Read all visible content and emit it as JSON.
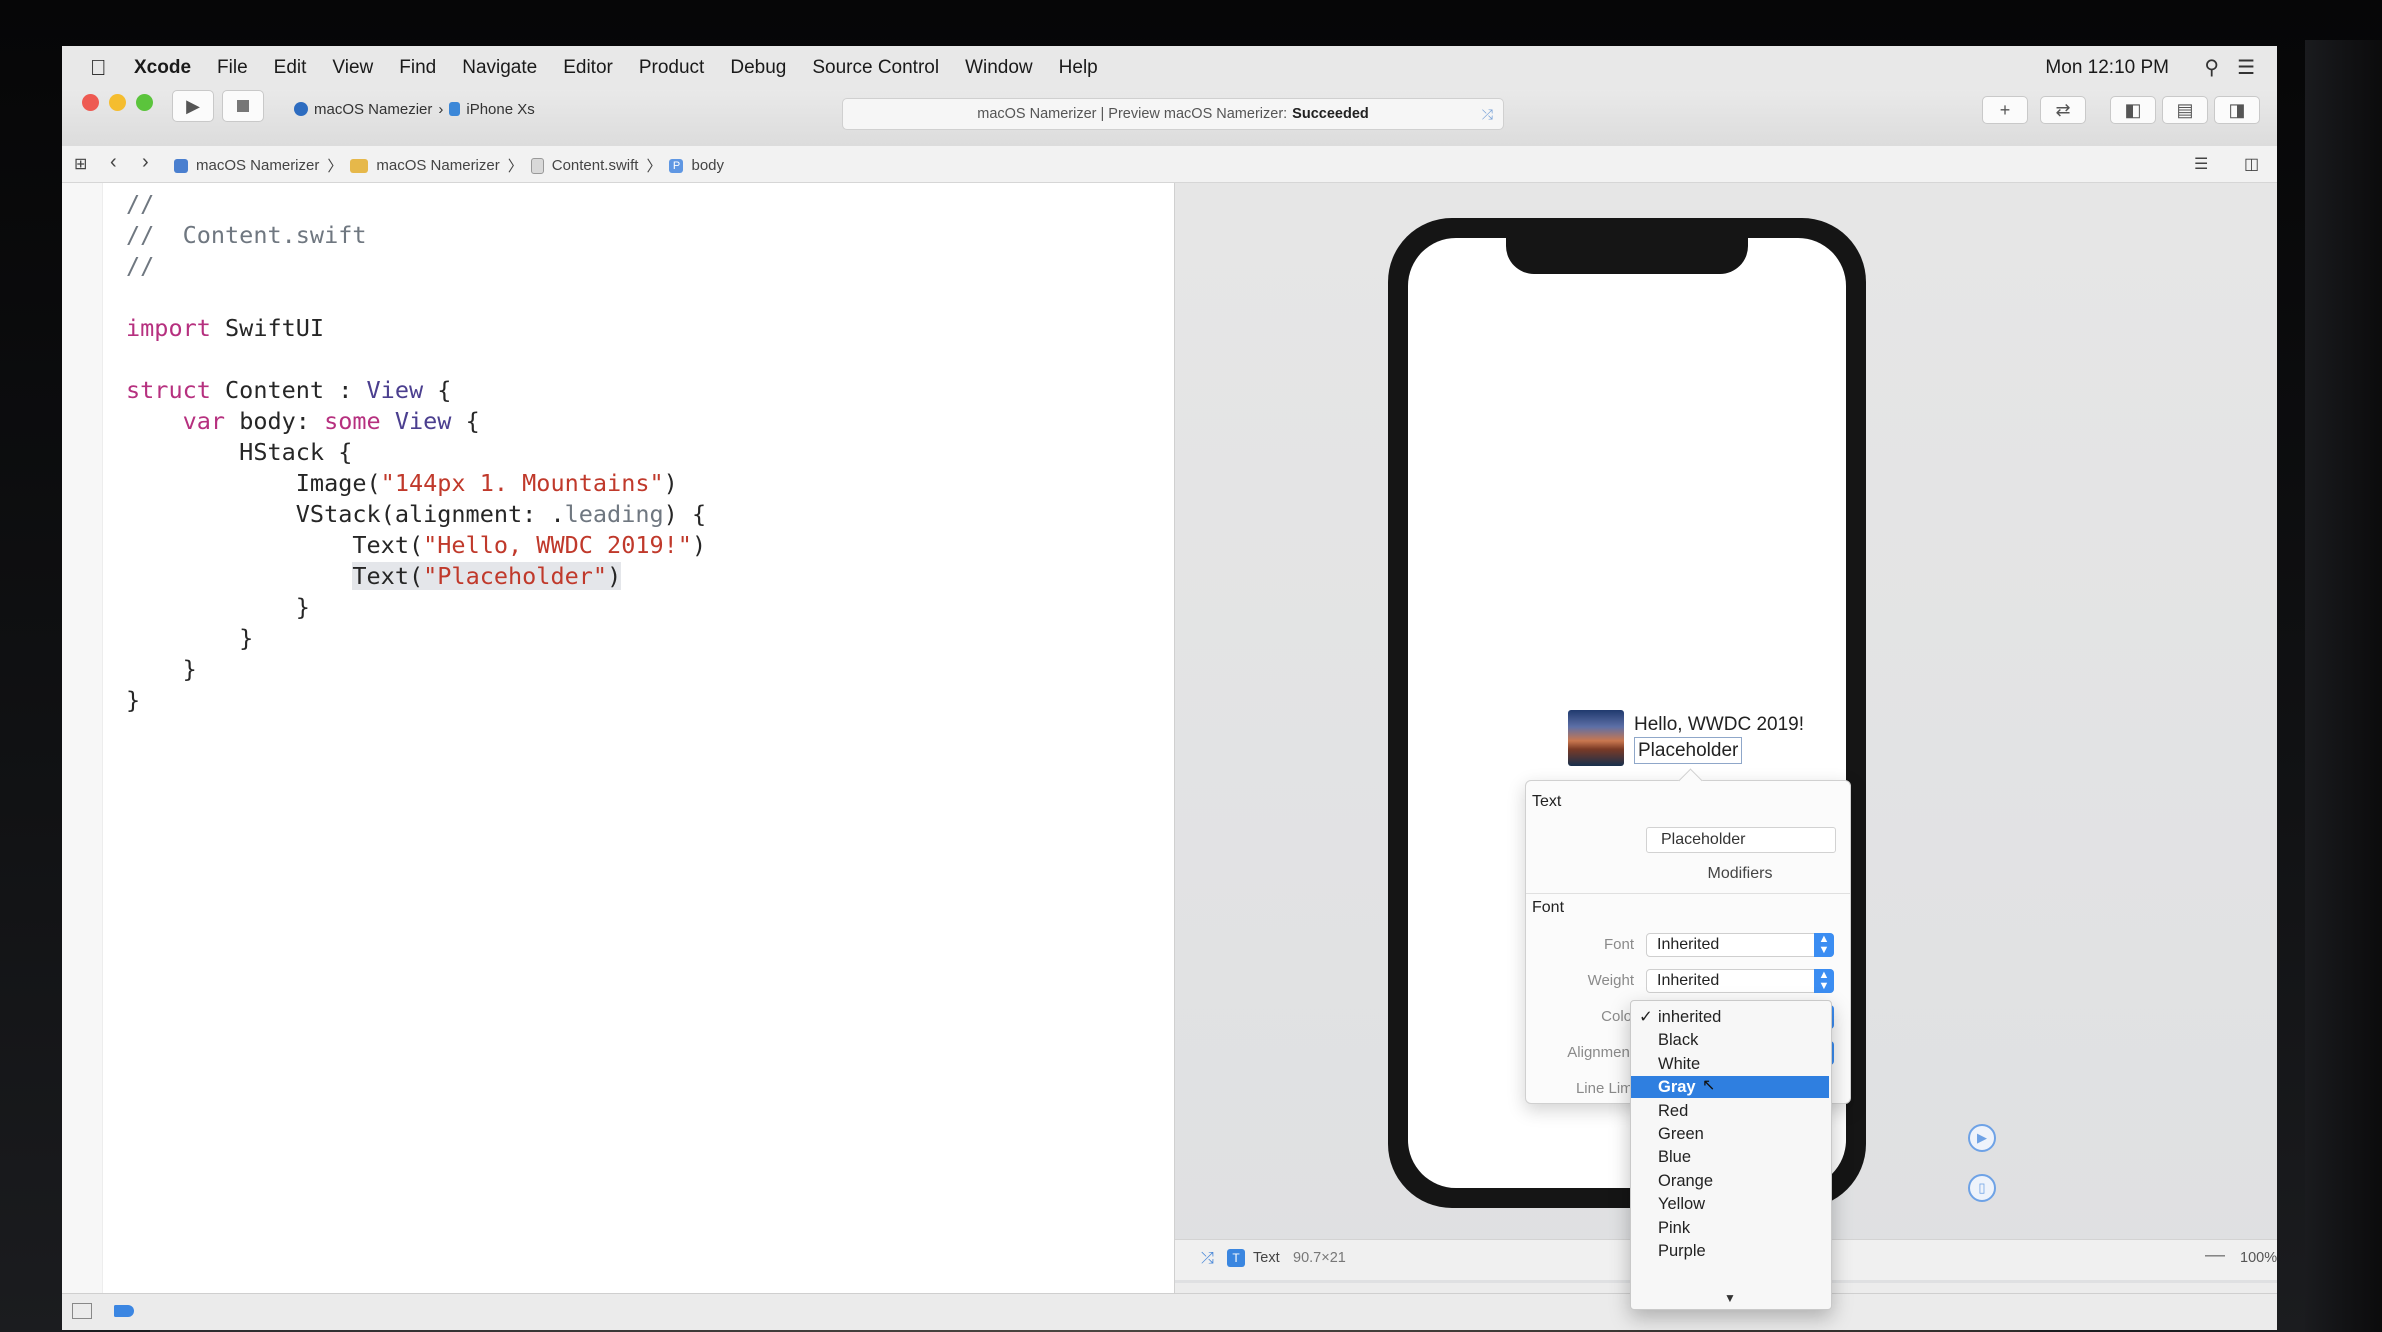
{
  "menubar": {
    "app": "Xcode",
    "items": [
      "File",
      "Edit",
      "View",
      "Find",
      "Navigate",
      "Editor",
      "Product",
      "Debug",
      "Source Control",
      "Window",
      "Help"
    ],
    "clock": "Mon 12:10 PM"
  },
  "toolbar": {
    "scheme": "macOS Namezier",
    "device": "iPhone Xs",
    "activity_prefix": "macOS Namerizer | Preview macOS Namerizer:",
    "activity_status": "Succeeded"
  },
  "jumpbar": {
    "crumbs": [
      "macOS Namerizer",
      "macOS Namerizer",
      "Content.swift",
      "body"
    ]
  },
  "code_lines": [
    [
      {
        "t": "//",
        "c": "cm"
      }
    ],
    [
      {
        "t": "//  Content.swift",
        "c": "cm"
      }
    ],
    [
      {
        "t": "//",
        "c": "cm"
      }
    ],
    [
      {
        "t": "",
        "c": "pl"
      }
    ],
    [
      {
        "t": "import",
        "c": "kw"
      },
      {
        "t": " SwiftUI",
        "c": "pl"
      }
    ],
    [
      {
        "t": "",
        "c": "pl"
      }
    ],
    [
      {
        "t": "struct",
        "c": "kw"
      },
      {
        "t": " Content : ",
        "c": "pl"
      },
      {
        "t": "View",
        "c": "ty"
      },
      {
        "t": " {",
        "c": "pl"
      }
    ],
    [
      {
        "t": "    ",
        "c": "pl"
      },
      {
        "t": "var",
        "c": "kw"
      },
      {
        "t": " body: ",
        "c": "pl"
      },
      {
        "t": "some",
        "c": "kw"
      },
      {
        "t": " ",
        "c": "pl"
      },
      {
        "t": "View",
        "c": "ty"
      },
      {
        "t": " {",
        "c": "pl"
      }
    ],
    [
      {
        "t": "        HStack {",
        "c": "pl"
      }
    ],
    [
      {
        "t": "            Image(",
        "c": "pl"
      },
      {
        "t": "\"144px 1. Mountains\"",
        "c": "st"
      },
      {
        "t": ")",
        "c": "pl"
      }
    ],
    [
      {
        "t": "            VStack(alignment: .",
        "c": "pl"
      },
      {
        "t": "leading",
        "c": "cm"
      },
      {
        "t": ") {",
        "c": "pl"
      }
    ],
    [
      {
        "t": "                Text(",
        "c": "pl"
      },
      {
        "t": "\"Hello, WWDC 2019!\"",
        "c": "st"
      },
      {
        "t": ")",
        "c": "pl"
      }
    ],
    [
      {
        "t": "                ",
        "c": "pl"
      },
      {
        "t": "Text(",
        "c": "pl sel"
      },
      {
        "t": "\"Placeholder\"",
        "c": "st sel"
      },
      {
        "t": ")",
        "c": "pl sel"
      }
    ],
    [
      {
        "t": "            }",
        "c": "pl"
      }
    ],
    [
      {
        "t": "        }",
        "c": "pl"
      }
    ],
    [
      {
        "t": "    }",
        "c": "pl"
      }
    ],
    [
      {
        "t": "}",
        "c": "pl"
      }
    ]
  ],
  "preview": {
    "title": "Hello, WWDC 2019!",
    "placeholder": "Placeholder"
  },
  "inspector": {
    "text_section": "Text",
    "text_value": "Placeholder",
    "modifiers": "Modifiers",
    "font_section": "Font",
    "font_label": "Font",
    "font_value": "Inherited",
    "weight_label": "Weight",
    "weight_value": "Inherited",
    "color_label": "Colo",
    "alignment_label": "Alignment",
    "line_limit_label": "Line Limi"
  },
  "color_menu": {
    "checked": "✓",
    "items": [
      "inherited",
      "Black",
      "White",
      "Gray",
      "Red",
      "Green",
      "Blue",
      "Orange",
      "Yellow",
      "Pink",
      "Purple"
    ],
    "highlighted": "Gray",
    "more": "▼"
  },
  "canvas_bar": {
    "element": "Text",
    "size": "90.7×21",
    "zoom": "100%"
  },
  "colors": {
    "accent": "#2f7fe0",
    "keyword": "#b6307f",
    "string": "#c0392b",
    "comment": "#6f7780"
  }
}
